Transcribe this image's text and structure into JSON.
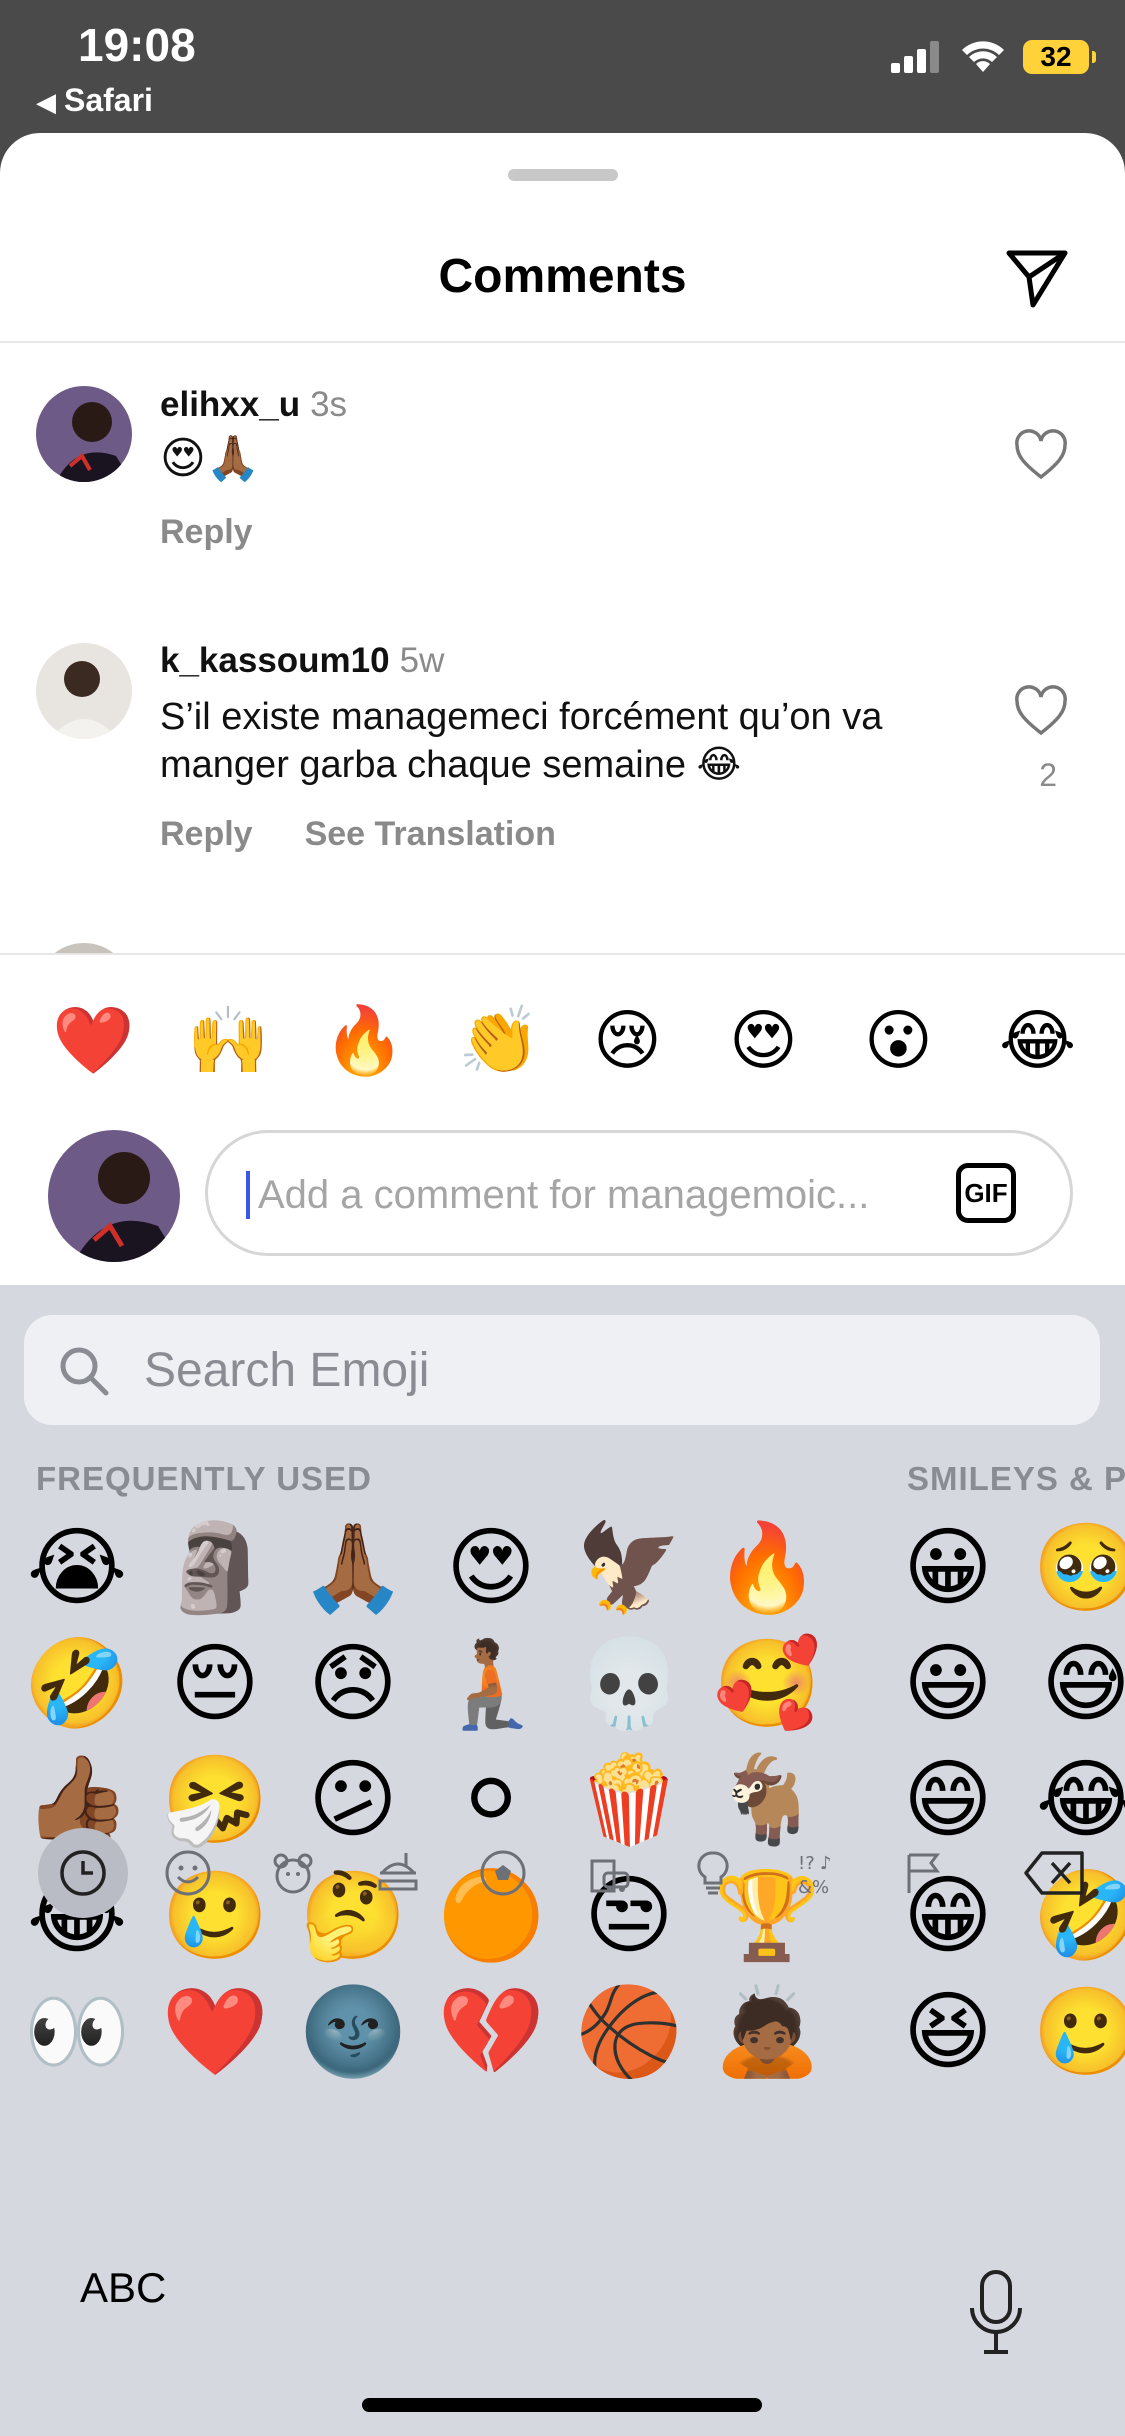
{
  "status_bar": {
    "time": "19:08",
    "back_app": "Safari",
    "battery": "32"
  },
  "sheet": {
    "title": "Comments"
  },
  "comments": [
    {
      "user": "elihxx_u",
      "time": "3s",
      "text": "😍🙏🏾",
      "actions": [
        "Reply"
      ],
      "likes": ""
    },
    {
      "user": "k_kassoum10",
      "time": "5w",
      "text": "S’il existe managemeci forcément qu’on va manger garba chaque semaine 😂",
      "actions": [
        "Reply",
        "See Translation"
      ],
      "likes": "2"
    }
  ],
  "quick_reactions": [
    "❤️",
    "🙌",
    "🔥",
    "👏",
    "😢",
    "😍",
    "😮",
    "😂"
  ],
  "composer": {
    "placeholder": "Add a comment for managemoic...",
    "gif_label": "GIF"
  },
  "keyboard": {
    "search_placeholder": "Search Emoji",
    "sections": [
      "FREQUENTLY USED",
      "SMILEYS & P"
    ],
    "frequently_used": [
      [
        "😭",
        "🗿",
        "🙏🏾",
        "😍",
        "🦅",
        "🔥"
      ],
      [
        "🤣",
        "😔",
        "😞",
        "🧎🏾",
        "💀",
        "🥰"
      ],
      [
        "👍🏾",
        "🤧",
        "😕",
        "⚪",
        "🍿",
        "🐐"
      ],
      [
        "😂",
        "🥲",
        "🤔",
        "🟠",
        "😒",
        "🏆"
      ],
      [
        "👀",
        "❤️",
        "🌚",
        "💔",
        "🏀",
        "🙇🏾"
      ]
    ],
    "smileys": [
      [
        "😀",
        "🥹"
      ],
      [
        "😃",
        "😅"
      ],
      [
        "😄",
        "😂"
      ],
      [
        "😁",
        "🤣"
      ],
      [
        "😆",
        "🥲"
      ]
    ],
    "categories": [
      "recent-icon",
      "smileys-icon",
      "animals-icon",
      "food-icon",
      "activity-icon",
      "travel-icon",
      "objects-icon",
      "symbols-icon",
      "flags-icon",
      "delete-icon"
    ],
    "abc_label": "ABC"
  }
}
